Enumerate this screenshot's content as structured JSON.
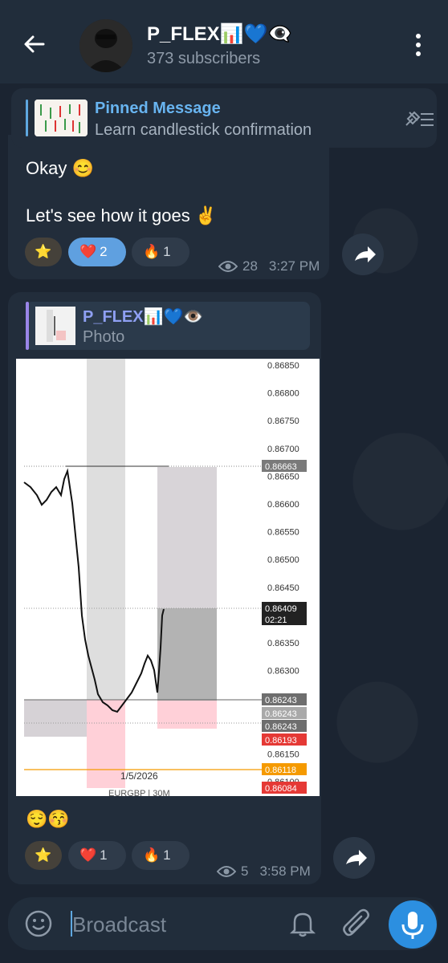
{
  "channel": {
    "title": "P_FLEX📊💙👁️‍🗨️",
    "title_text": "P_FLEX",
    "subscribers": "373 subscribers"
  },
  "pinned": {
    "label": "Pinned Message",
    "text": "Learn candlestick confirmation"
  },
  "message1": {
    "line1": "Okay 😊",
    "line2": "Let's see how it goes ✌️",
    "reactions": [
      {
        "emoji": "⭐",
        "count": ""
      },
      {
        "emoji": "❤️",
        "count": "2"
      },
      {
        "emoji": "🔥",
        "count": "1"
      }
    ],
    "views": "28",
    "time": "3:27 PM"
  },
  "message2": {
    "forward_name": "P_FLEX📊💙👁️",
    "forward_type": "Photo",
    "caption": "😌😚",
    "reactions": [
      {
        "emoji": "⭐",
        "count": ""
      },
      {
        "emoji": "❤️",
        "count": "1"
      },
      {
        "emoji": "🔥",
        "count": "1"
      }
    ],
    "views": "5",
    "time": "3:58 PM"
  },
  "chart_image": {
    "price_labels": [
      "0.86850",
      "0.86800",
      "0.86750",
      "0.86700",
      "0.86650",
      "0.86600",
      "0.86550",
      "0.86500",
      "0.86450",
      "0.86400",
      "0.86350",
      "0.86300",
      "0.86250",
      "0.86150",
      "0.86100"
    ],
    "tags": [
      {
        "text": "0.86663",
        "color": "#7a7a7a"
      },
      {
        "text": "0.86409",
        "color": "#222222"
      },
      {
        "text": "02:21",
        "color": "#222222"
      },
      {
        "text": "0.86243",
        "color": "#6e6e6e"
      },
      {
        "text": "0.86243",
        "color": "#a9a9a9"
      },
      {
        "text": "0.86243",
        "color": "#6e6e6e"
      },
      {
        "text": "0.86193",
        "color": "#e53935"
      },
      {
        "text": "0.86118",
        "color": "#f59a00"
      },
      {
        "text": "0.86084",
        "color": "#e53935"
      }
    ],
    "date_label": "1/5/2026",
    "symbol_label": "EURGBP | 30M"
  },
  "input": {
    "placeholder": "Broadcast"
  },
  "icons": {
    "back": "arrow-left-icon",
    "more": "more-vertical-icon",
    "unpin": "unpin-icon",
    "share": "share-icon",
    "emoji": "emoji-icon",
    "bell": "bell-icon",
    "attach": "paperclip-icon",
    "mic": "mic-icon",
    "views": "eye-icon"
  }
}
